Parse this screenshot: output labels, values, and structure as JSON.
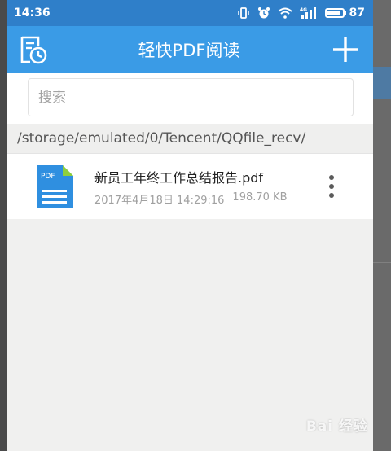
{
  "status_bar": {
    "time": "14:36",
    "battery_level": "87",
    "network_label": "4G"
  },
  "app_bar": {
    "title": "轻快PDF阅读"
  },
  "search": {
    "placeholder": "搜索",
    "value": ""
  },
  "path": {
    "current": "/storage/emulated/0/Tencent/QQfile_recv/"
  },
  "files": [
    {
      "name": "新员工年终工作总结报告.pdf",
      "date": "2017年4月18日 14:29:16",
      "size": "198.70 KB",
      "icon_label": "PDF"
    }
  ],
  "watermark": "Bai 经验",
  "colors": {
    "status_bar": "#2f7fc9",
    "app_bar": "#3a9be6",
    "file_icon": "#2f8fe0",
    "file_icon_accent": "#8fcf3c"
  }
}
